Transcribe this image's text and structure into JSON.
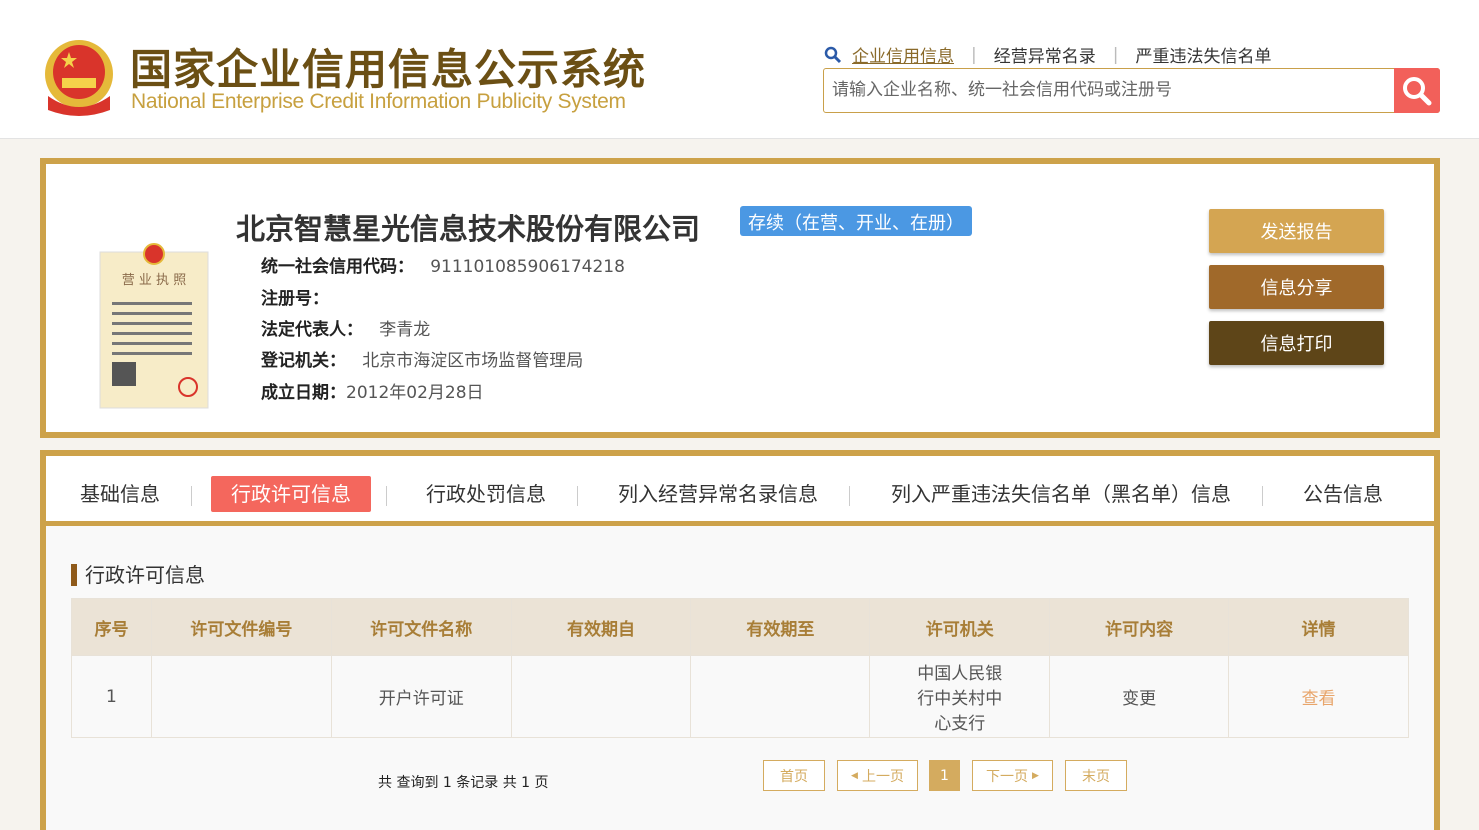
{
  "header": {
    "title_cn": "国家企业信用信息公示系统",
    "title_en": "National Enterprise Credit Information Publicity System",
    "links": [
      "企业信用信息",
      "经营异常名录",
      "严重违法失信名单"
    ],
    "search_placeholder": "请输入企业名称、统一社会信用代码或注册号"
  },
  "company": {
    "name": "北京智慧星光信息技术股份有限公司",
    "status": "存续（在营、开业、在册）",
    "fields": [
      {
        "label": "统一社会信用代码：",
        "value": "911101085906174218"
      },
      {
        "label": "注册号：",
        "value": ""
      },
      {
        "label": "法定代表人：",
        "value": "李青龙"
      },
      {
        "label": "登记机关：",
        "value": "北京市海淀区市场监督管理局"
      },
      {
        "label": "成立日期：",
        "value": "2012年02月28日"
      }
    ],
    "actions": [
      "发送报告",
      "信息分享",
      "信息打印"
    ]
  },
  "tabs": [
    "基础信息",
    "行政许可信息",
    "行政处罚信息",
    "列入经营异常名录信息",
    "列入严重违法失信名单（黑名单）信息",
    "公告信息"
  ],
  "section": {
    "title": "行政许可信息",
    "columns": [
      "序号",
      "许可文件编号",
      "许可文件名称",
      "有效期自",
      "有效期至",
      "许可机关",
      "许可内容",
      "详情"
    ],
    "rows": [
      {
        "no": "1",
        "file_no": "",
        "file_name": "开户许可证",
        "from": "",
        "to": "",
        "authority": "中国人民银行中关村中心支行",
        "content": "变更",
        "detail": "查看"
      }
    ]
  },
  "pager": {
    "summary": "共 查询到 1 条记录 共 1 页",
    "first": "首页",
    "prev": "上一页",
    "current": "1",
    "next": "下一页",
    "last": "末页"
  },
  "colors": {
    "gold": "#cda24a",
    "active_tab": "#f4675d",
    "status": "#4b98e3"
  }
}
